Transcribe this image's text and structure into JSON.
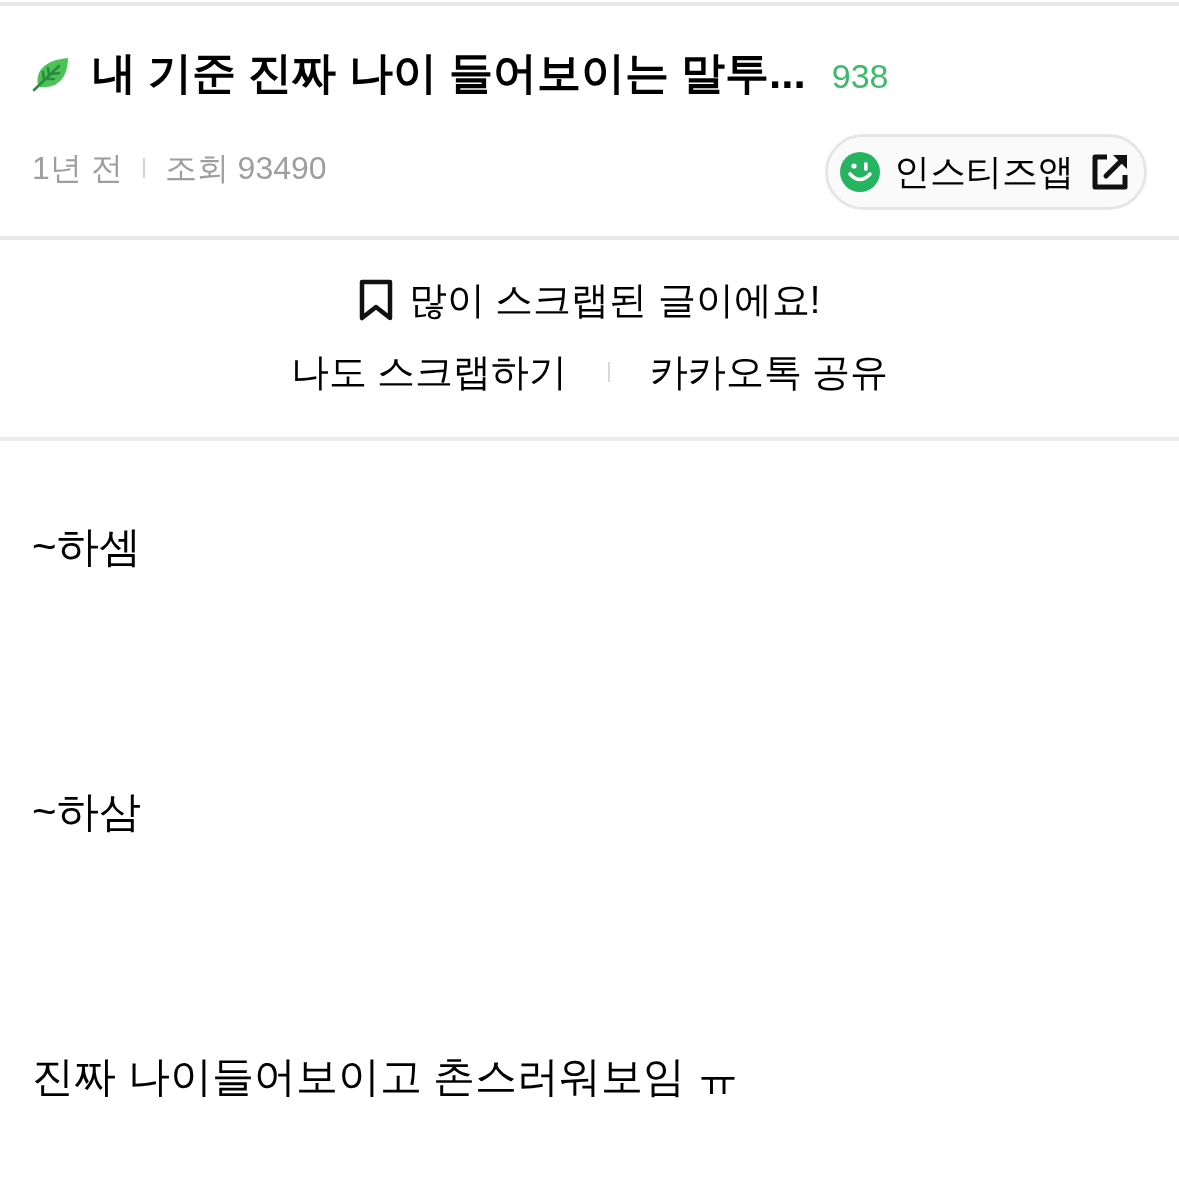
{
  "post": {
    "title": "내 기준 진짜 나이 들어보이는 말투...",
    "comment_count": "938",
    "time": "1년 전",
    "views": "조회 93490"
  },
  "app_button": {
    "label": "인스티즈앱"
  },
  "scrap": {
    "notice": "많이 스크랩된 글이에요!",
    "actions": [
      {
        "label": "나도 스크랩하기"
      },
      {
        "label": "카카오톡 공유"
      }
    ]
  },
  "body": {
    "paragraphs": [
      "~하셈",
      "~하삼",
      "진짜 나이들어보이고 촌스러워보임 ㅠ"
    ]
  }
}
